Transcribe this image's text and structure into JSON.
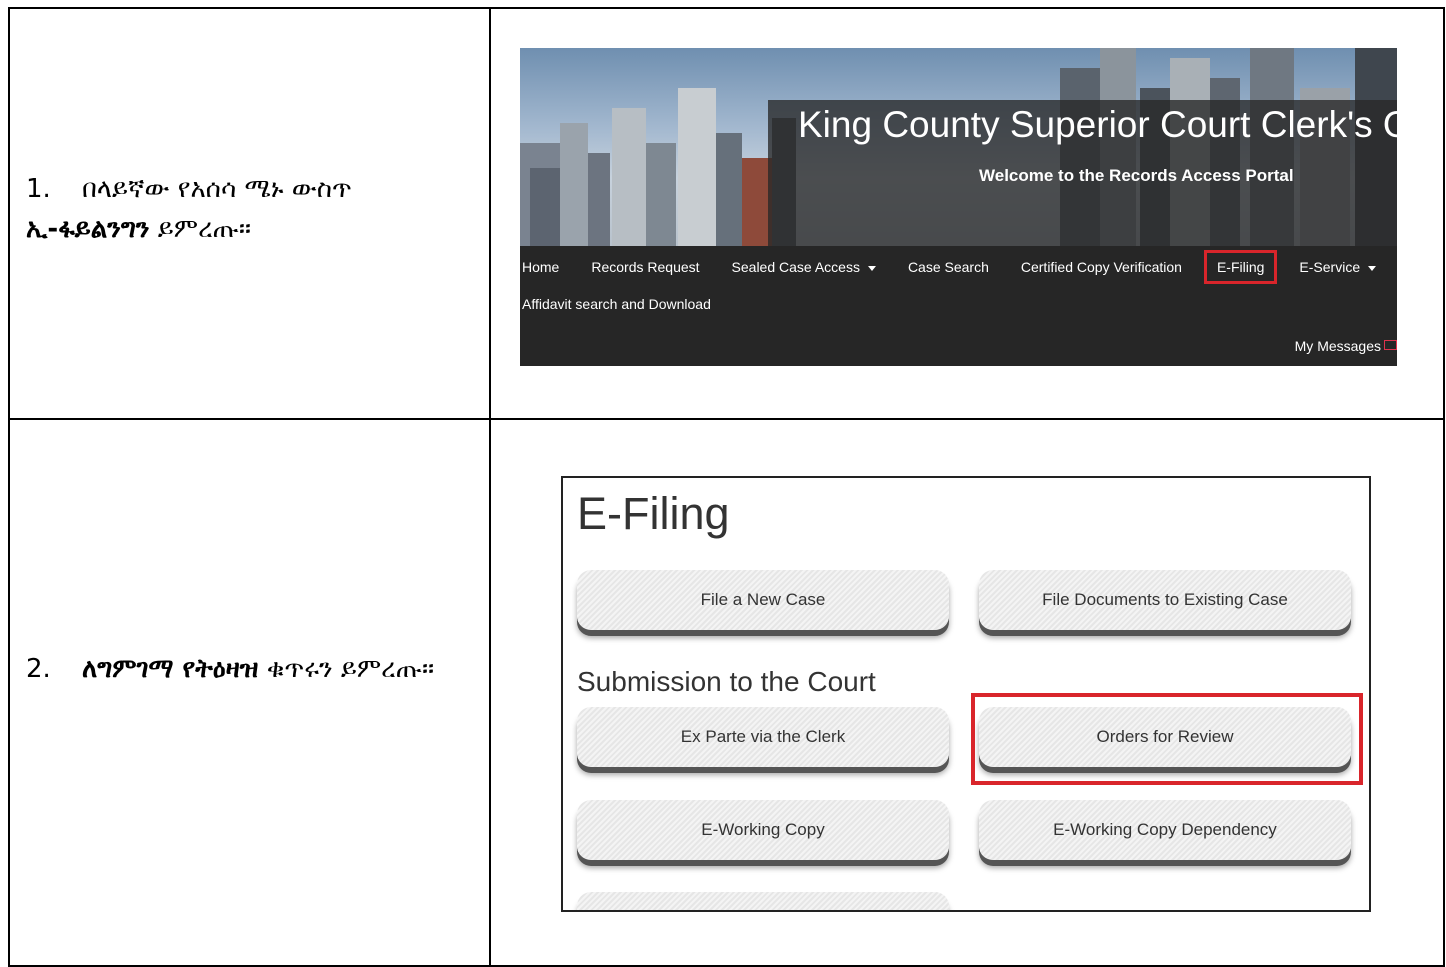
{
  "steps": [
    {
      "number": "1.",
      "before": "በላይኛው የአሰሳ ሜኑ ውስጥ ",
      "bold": "ኢ-ፋይልንግን",
      "after": " ይምረጡ።"
    },
    {
      "number": "2.",
      "before": "",
      "bold": "ለግምገማ የትዕዛዝ",
      "after": " ቁጥሩን ይምረጡ።"
    }
  ],
  "portal": {
    "title": "King County Superior Court Clerk's O",
    "subtitle": "Welcome to the Records Access Portal",
    "nav": [
      "Home",
      "Records Request",
      "Sealed Case Access",
      "Case Search",
      "Certified Copy Verification",
      "E-Filing",
      "E-Service"
    ],
    "nav_row2": "Affidavit search and Download",
    "messages": "My Messages",
    "colors": {
      "highlight": "#d9252b",
      "navbar": "#262626"
    }
  },
  "efiling": {
    "title": "E-Filing",
    "section": "Submission to the Court",
    "buttons": [
      "File a New Case",
      "File Documents to Existing Case",
      "Ex Parte via the Clerk",
      "Orders for Review",
      "E-Working Copy",
      "E-Working Copy Dependency"
    ]
  }
}
